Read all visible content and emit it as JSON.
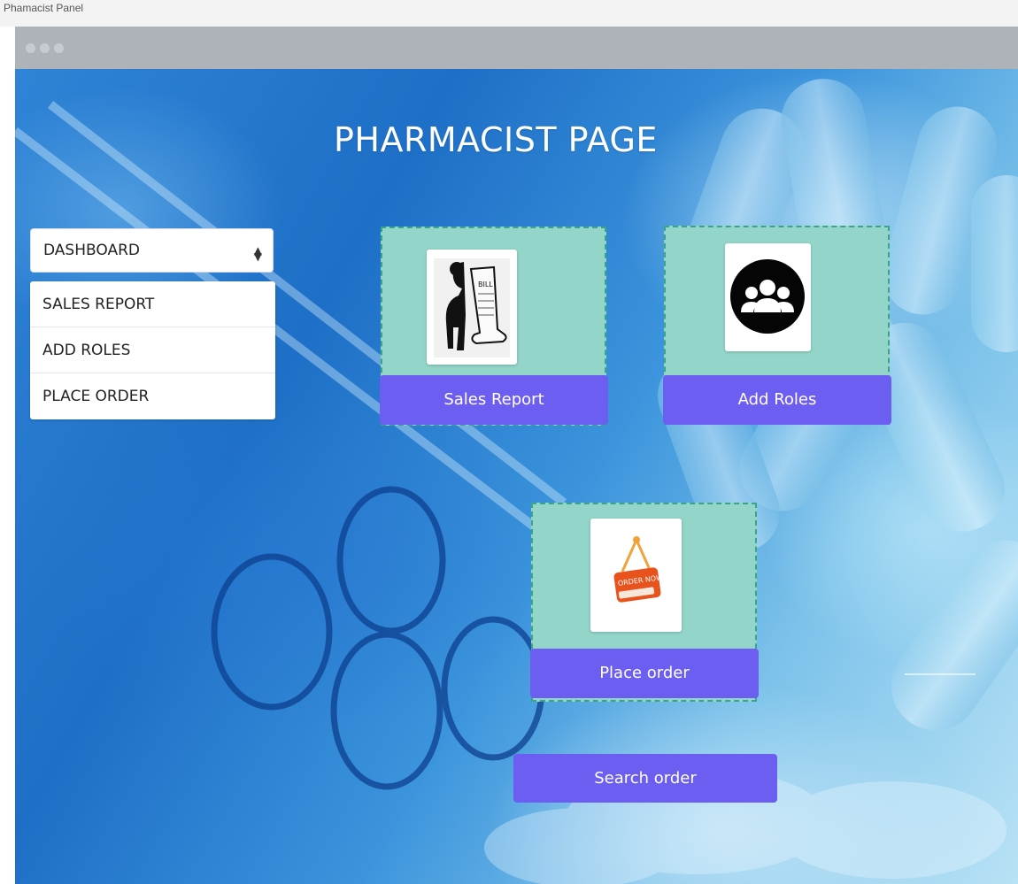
{
  "window": {
    "title": "Phamacist Panel"
  },
  "page": {
    "title": "PHARMACIST PAGE"
  },
  "menu": {
    "selected": "DASHBOARD",
    "items": [
      {
        "label": "SALES REPORT"
      },
      {
        "label": "ADD ROLES"
      },
      {
        "label": "PLACE ORDER"
      }
    ]
  },
  "cards": [
    {
      "label": "Sales Report",
      "icon": "bill-man-icon"
    },
    {
      "label": "Add Roles",
      "icon": "users-group-icon"
    },
    {
      "label": "Place order",
      "icon": "order-now-sign-icon",
      "sign_text": "ORDER NOW"
    }
  ],
  "search": {
    "label": "Search order"
  },
  "colors": {
    "button": "#6c5ef0",
    "card": "#93d5c9",
    "card_border": "#3aa48a",
    "chrome": "#aeb3ba"
  }
}
